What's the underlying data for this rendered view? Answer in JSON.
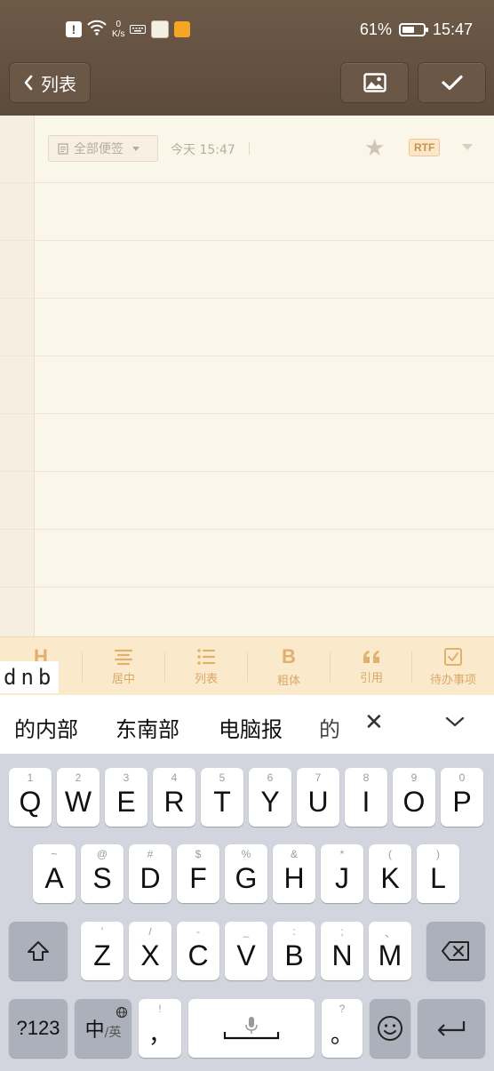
{
  "status_bar": {
    "net_speed_value": "0",
    "net_speed_unit": "K/s",
    "battery_percent": "61%",
    "battery_level": 0.61,
    "time": "15:47"
  },
  "nav": {
    "back_label": "列表",
    "insert_image_icon": "image-icon",
    "done_icon": "check-icon"
  },
  "note": {
    "folder_label": "全部便签",
    "date_label": "今天 15:47",
    "format_badge": "RTF"
  },
  "toolbar": {
    "heading_icon": "H",
    "items": [
      {
        "label": "居中",
        "icon": "align-center-icon"
      },
      {
        "label": "列表",
        "icon": "list-icon"
      },
      {
        "label": "粗体",
        "icon": "B"
      },
      {
        "label": "引用",
        "icon": "quote-icon"
      },
      {
        "label": "待办事项",
        "icon": "checkbox-icon"
      }
    ]
  },
  "ime": {
    "composing_text": "dnb",
    "candidates": [
      "的内部",
      "东南部",
      "电脑报",
      "的"
    ]
  },
  "keyboard": {
    "row1": [
      {
        "key": "Q",
        "hint": "1"
      },
      {
        "key": "W",
        "hint": "2"
      },
      {
        "key": "E",
        "hint": "3"
      },
      {
        "key": "R",
        "hint": "4"
      },
      {
        "key": "T",
        "hint": "5"
      },
      {
        "key": "Y",
        "hint": "6"
      },
      {
        "key": "U",
        "hint": "7"
      },
      {
        "key": "I",
        "hint": "8"
      },
      {
        "key": "O",
        "hint": "9"
      },
      {
        "key": "P",
        "hint": "0"
      }
    ],
    "row2": [
      {
        "key": "A",
        "hint": "~"
      },
      {
        "key": "S",
        "hint": "@"
      },
      {
        "key": "D",
        "hint": "#"
      },
      {
        "key": "F",
        "hint": "$"
      },
      {
        "key": "G",
        "hint": "%"
      },
      {
        "key": "H",
        "hint": "&"
      },
      {
        "key": "J",
        "hint": "*"
      },
      {
        "key": "K",
        "hint": "("
      },
      {
        "key": "L",
        "hint": ")"
      }
    ],
    "row3": [
      {
        "key": "Z",
        "hint": "'"
      },
      {
        "key": "X",
        "hint": "/"
      },
      {
        "key": "C",
        "hint": "-"
      },
      {
        "key": "V",
        "hint": "_"
      },
      {
        "key": "B",
        "hint": ":"
      },
      {
        "key": "N",
        "hint": ";"
      },
      {
        "key": "M",
        "hint": "、"
      }
    ],
    "numbers_key": "?123",
    "lang_key_main": "中",
    "lang_key_sub": "/英",
    "comma_key": "，",
    "comma_hint": "!",
    "period_key": "。",
    "period_hint": "?"
  }
}
